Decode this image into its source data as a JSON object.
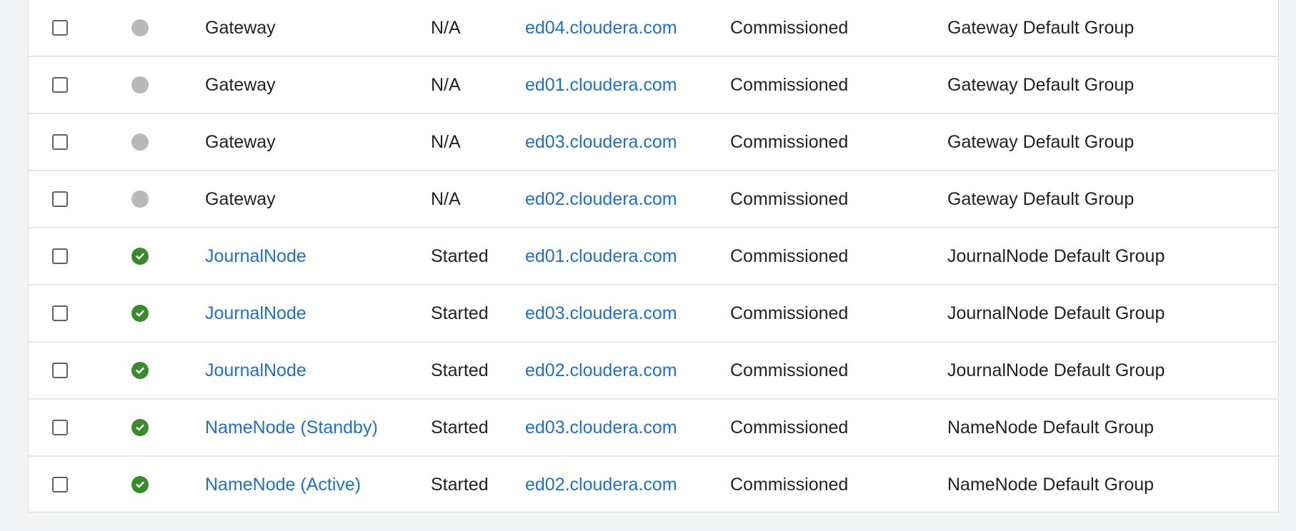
{
  "colors": {
    "link": "#1f6fd1",
    "status_good": "#3c8a2e",
    "status_unknown": "#b7b9bd"
  },
  "rows": [
    {
      "status": "unknown",
      "status_icon": "gray-circle-icon",
      "role": "Gateway",
      "role_is_link": false,
      "state": "N/A",
      "host": "ed04.cloudera.com",
      "commission_state": "Commissioned",
      "role_group": "Gateway Default Group"
    },
    {
      "status": "unknown",
      "status_icon": "gray-circle-icon",
      "role": "Gateway",
      "role_is_link": false,
      "state": "N/A",
      "host": "ed01.cloudera.com",
      "commission_state": "Commissioned",
      "role_group": "Gateway Default Group"
    },
    {
      "status": "unknown",
      "status_icon": "gray-circle-icon",
      "role": "Gateway",
      "role_is_link": false,
      "state": "N/A",
      "host": "ed03.cloudera.com",
      "commission_state": "Commissioned",
      "role_group": "Gateway Default Group"
    },
    {
      "status": "unknown",
      "status_icon": "gray-circle-icon",
      "role": "Gateway",
      "role_is_link": false,
      "state": "N/A",
      "host": "ed02.cloudera.com",
      "commission_state": "Commissioned",
      "role_group": "Gateway Default Group"
    },
    {
      "status": "good",
      "status_icon": "green-check-circle-icon",
      "role": "JournalNode",
      "role_is_link": true,
      "state": "Started",
      "host": "ed01.cloudera.com",
      "commission_state": "Commissioned",
      "role_group": "JournalNode Default Group"
    },
    {
      "status": "good",
      "status_icon": "green-check-circle-icon",
      "role": "JournalNode",
      "role_is_link": true,
      "state": "Started",
      "host": "ed03.cloudera.com",
      "commission_state": "Commissioned",
      "role_group": "JournalNode Default Group"
    },
    {
      "status": "good",
      "status_icon": "green-check-circle-icon",
      "role": "JournalNode",
      "role_is_link": true,
      "state": "Started",
      "host": "ed02.cloudera.com",
      "commission_state": "Commissioned",
      "role_group": "JournalNode Default Group"
    },
    {
      "status": "good",
      "status_icon": "green-check-circle-icon",
      "role": "NameNode (Standby)",
      "role_is_link": true,
      "state": "Started",
      "host": "ed03.cloudera.com",
      "commission_state": "Commissioned",
      "role_group": "NameNode Default Group"
    },
    {
      "status": "good",
      "status_icon": "green-check-circle-icon",
      "role": "NameNode (Active)",
      "role_is_link": true,
      "state": "Started",
      "host": "ed02.cloudera.com",
      "commission_state": "Commissioned",
      "role_group": "NameNode Default Group"
    }
  ]
}
